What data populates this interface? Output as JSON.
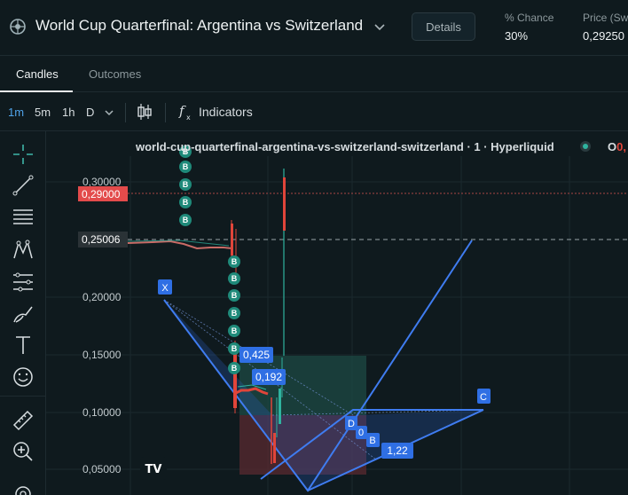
{
  "header": {
    "title": "World Cup Quarterfinal: Argentina vs Switzerland",
    "details_label": "Details",
    "chance_label": "% Chance",
    "chance_value": "30%",
    "price_label": "Price (Sw",
    "price_value": "0,29250"
  },
  "tabs": [
    {
      "label": "Candles",
      "active": true
    },
    {
      "label": "Outcomes",
      "active": false
    }
  ],
  "toolbar": {
    "timeframes": [
      "1m",
      "5m",
      "1h",
      "D"
    ],
    "active_timeframe": "1m",
    "indicators_label": "Indicators"
  },
  "left_tools": [
    "crosshair-icon",
    "trendline-icon",
    "fib-icon",
    "pattern-icon",
    "projection-icon",
    "brush-icon",
    "text-icon",
    "emoji-icon",
    "ruler-icon",
    "zoom-in-icon",
    "magnet-icon"
  ],
  "chart": {
    "legend_title": "world-cup-quarterfinal-argentina-vs-switzerland-switzerland · 1 · Hyperliquid",
    "ohlc_prefix": "O",
    "ohlc_value": "0,",
    "price_axis": [
      "0,30000",
      "0,20000",
      "0,15000",
      "0,10000",
      "0,05000"
    ],
    "last_price_tag": "0,29000",
    "crosshair_price_tag": "0,25006",
    "pattern_labels": [
      "X",
      "D",
      "0",
      "B",
      "C"
    ],
    "ratio_labels": [
      "0,425",
      "0,192",
      "1,22"
    ],
    "buy_marker": "B",
    "logo_text": "TV",
    "colors": {
      "background": "#0f1a1e",
      "accent": "#2f6fe4",
      "up": "#26a69a",
      "down": "#e0453a",
      "marker": "#1f8a7a"
    }
  }
}
